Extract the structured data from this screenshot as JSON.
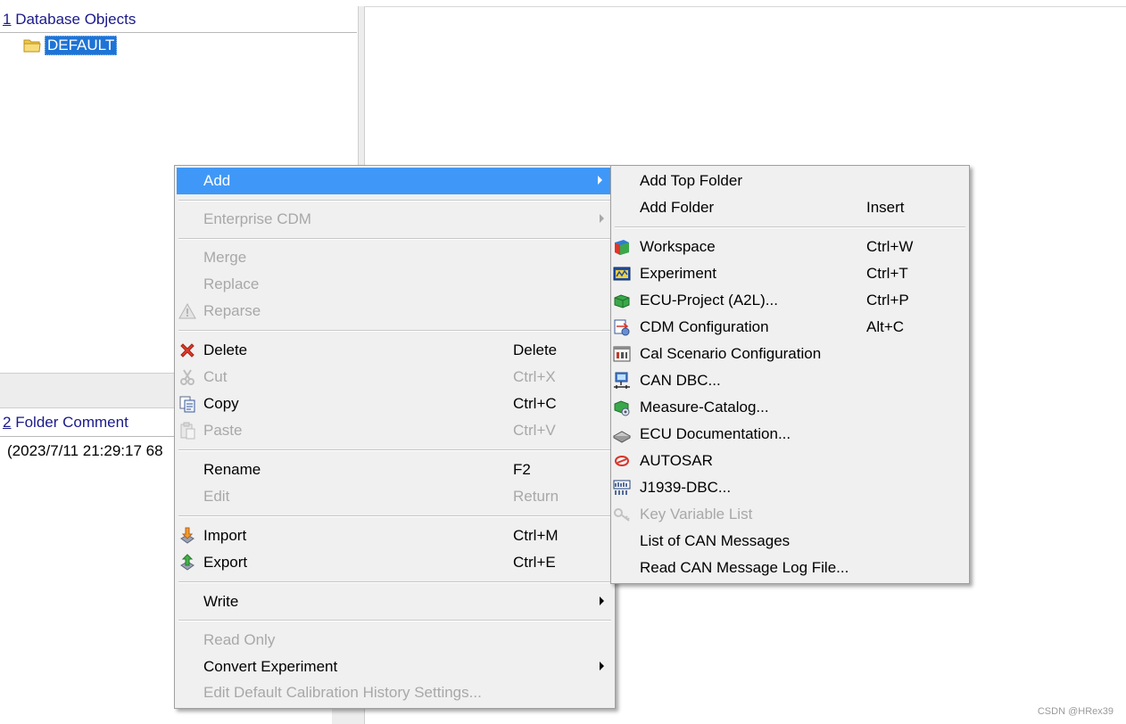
{
  "objects_pane": {
    "number": "1",
    "title": "Database Objects",
    "tree_item": "DEFAULT"
  },
  "comment_pane": {
    "number": "2",
    "title": "Folder Comment",
    "text": "(2023/7/11 21:29:17 68"
  },
  "main_menu": {
    "add": "Add",
    "enterprise_cdm": "Enterprise CDM",
    "merge": "Merge",
    "replace": "Replace",
    "reparse": "Reparse",
    "delete": "Delete",
    "delete_sc": "Delete",
    "cut": "Cut",
    "cut_sc": "Ctrl+X",
    "copy": "Copy",
    "copy_sc": "Ctrl+C",
    "paste": "Paste",
    "paste_sc": "Ctrl+V",
    "rename": "Rename",
    "rename_sc": "F2",
    "edit": "Edit",
    "edit_sc": "Return",
    "import": "Import",
    "import_sc": "Ctrl+M",
    "export": "Export",
    "export_sc": "Ctrl+E",
    "write": "Write",
    "read_only": "Read Only",
    "convert_experiment": "Convert Experiment",
    "edit_default_history": "Edit Default Calibration History Settings..."
  },
  "add_submenu": {
    "add_top_folder": "Add Top Folder",
    "add_folder": "Add Folder",
    "add_folder_sc": "Insert",
    "workspace": "Workspace",
    "workspace_sc": "Ctrl+W",
    "experiment": "Experiment",
    "experiment_sc": "Ctrl+T",
    "ecu_project": "ECU-Project (A2L)...",
    "ecu_project_sc": "Ctrl+P",
    "cdm_configuration": "CDM Configuration",
    "cdm_configuration_sc": "Alt+C",
    "cal_scenario": "Cal Scenario Configuration",
    "can_dbc": "CAN DBC...",
    "measure_catalog": "Measure-Catalog...",
    "ecu_documentation": "ECU Documentation...",
    "autosar": "AUTOSAR",
    "j1939_dbc": "J1939-DBC...",
    "key_variable_list": "Key Variable List",
    "list_can_messages": "List of CAN Messages",
    "read_can_log": "Read CAN Message Log File..."
  },
  "watermark": "CSDN @HRex39",
  "colors": {
    "highlight": "#3f98f7",
    "selection": "#1e74d6",
    "pane_title": "#1a1a8c",
    "menu_bg": "#f0f0f0"
  }
}
